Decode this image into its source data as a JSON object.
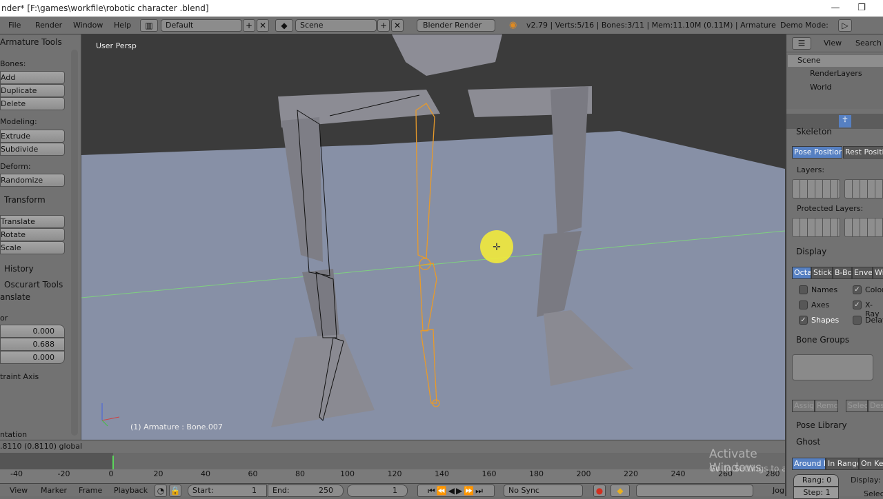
{
  "window": {
    "title": "nder* [F:\\games\\workfile\\robotic character .blend]",
    "minimize": "—",
    "restore": "❐"
  },
  "info": {
    "menus": [
      "File",
      "Render",
      "Window",
      "Help"
    ],
    "layout": "Default",
    "scene": "Scene",
    "engine": "Blender Render",
    "stats": "v2.79 | Verts:5/16 | Bones:3/11 | Mem:11.10M (0.11M) | Armature",
    "demo_mode": "Demo Mode:"
  },
  "toolshelf": {
    "armature_tools": "Armature Tools",
    "bones_label": "Bones:",
    "add": "Add",
    "duplicate": "Duplicate",
    "delete": "Delete",
    "modeling_label": "Modeling:",
    "extrude": "Extrude",
    "subdivide": "Subdivide",
    "deform_label": "Deform:",
    "randomize": "Randomize",
    "transform": "Transform",
    "translate": "Translate",
    "rotate": "Rotate",
    "scale": "Scale",
    "history": "History",
    "oscurart": "Oscurart Tools",
    "op_translate": "anslate",
    "vector_label": "or",
    "vector": [
      "0.000",
      "0.688",
      "0.000"
    ],
    "constraint_axis": "traint Axis",
    "orientation": "ntation"
  },
  "viewport": {
    "view_name": "User Persp",
    "status": "(1) Armature : Bone.007"
  },
  "header_readout": ".8110 (0.8110) global",
  "timeline": {
    "ticks": [
      "-40",
      "-20",
      "0",
      "20",
      "40",
      "60",
      "80",
      "100",
      "120",
      "140",
      "160",
      "180",
      "200",
      "220",
      "240",
      "260",
      "280"
    ],
    "menus": [
      "View",
      "Marker",
      "Frame",
      "Playback"
    ],
    "start": "Start:",
    "start_val": "1",
    "end": "End:",
    "end_val": "250",
    "current": "1",
    "sync": "No Sync",
    "jog": "Jog"
  },
  "outliner": {
    "view": "View",
    "search": "Search",
    "items": [
      "Scene",
      "RenderLayers",
      "World"
    ]
  },
  "properties": {
    "skeleton": "Skeleton",
    "pose_position": "Pose Position",
    "rest_position": "Rest Positio",
    "layers": "Layers:",
    "protected_layers": "Protected Layers:",
    "display": "Display",
    "display_tabs": [
      "Octa",
      "Stick",
      "B-Bo",
      "Envel",
      "Wi"
    ],
    "checks": [
      {
        "label": "Names",
        "checked": false
      },
      {
        "label": "Colors",
        "checked": true
      },
      {
        "label": "Axes",
        "checked": false
      },
      {
        "label": "X-Ray",
        "checked": true
      },
      {
        "label": "Shapes",
        "checked": true
      },
      {
        "label": "Delay",
        "checked": false
      }
    ],
    "bone_groups": "Bone Groups",
    "assign": "Assign",
    "remove": "Remo",
    "select": "Select",
    "deselect": "Des",
    "pose_library": "Pose Library",
    "ghost": "Ghost",
    "ghost_tabs": [
      "Around F",
      "In Range",
      "On Key"
    ],
    "range": "Rang: 0",
    "step": "Step: 1",
    "display_label": "Display:",
    "selected": "Selec"
  },
  "watermark": {
    "line1": "Activate Windows",
    "line2": "Go to Settings to activate Windows."
  }
}
